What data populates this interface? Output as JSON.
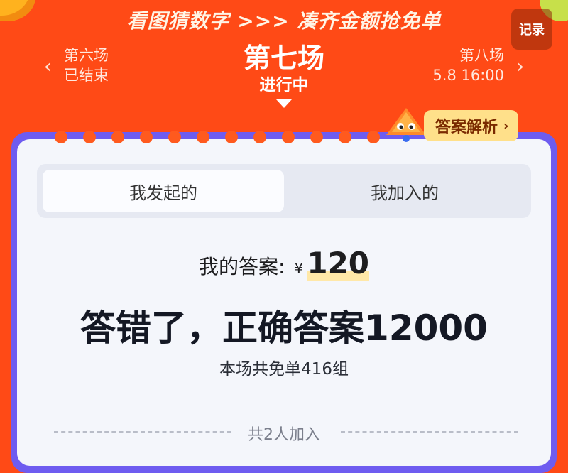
{
  "banner": {
    "text": "看图猜数字 >>> 凑齐金额抢免单"
  },
  "header": {
    "record_label": "记录"
  },
  "sessions": {
    "prev": {
      "title": "第六场",
      "status": "已结束"
    },
    "current": {
      "title": "第七场",
      "status": "进行中"
    },
    "next": {
      "title": "第八场",
      "time": "5.8 16:00"
    }
  },
  "analysis": {
    "label": "答案解析",
    "chevron": "›"
  },
  "tabs": [
    {
      "label": "我发起的",
      "active": true
    },
    {
      "label": "我加入的",
      "active": false
    }
  ],
  "answer": {
    "label": "我的答案:",
    "currency": "¥",
    "value": "120"
  },
  "result": {
    "text": "答错了，正确答案12000"
  },
  "free_count": {
    "text": "本场共免单416组"
  },
  "participants": {
    "text": "共2人加入"
  },
  "colors": {
    "background": "#ff4a16",
    "card": "#f4f6fb",
    "card_shadow": "#6e5cf0",
    "analysis_button": "#ffe08a"
  },
  "icons": {
    "arrow_left": "chevron-left-icon",
    "arrow_right": "chevron-right-icon",
    "current_marker": "triangle-down-icon",
    "mascot": "mascot-icon"
  }
}
